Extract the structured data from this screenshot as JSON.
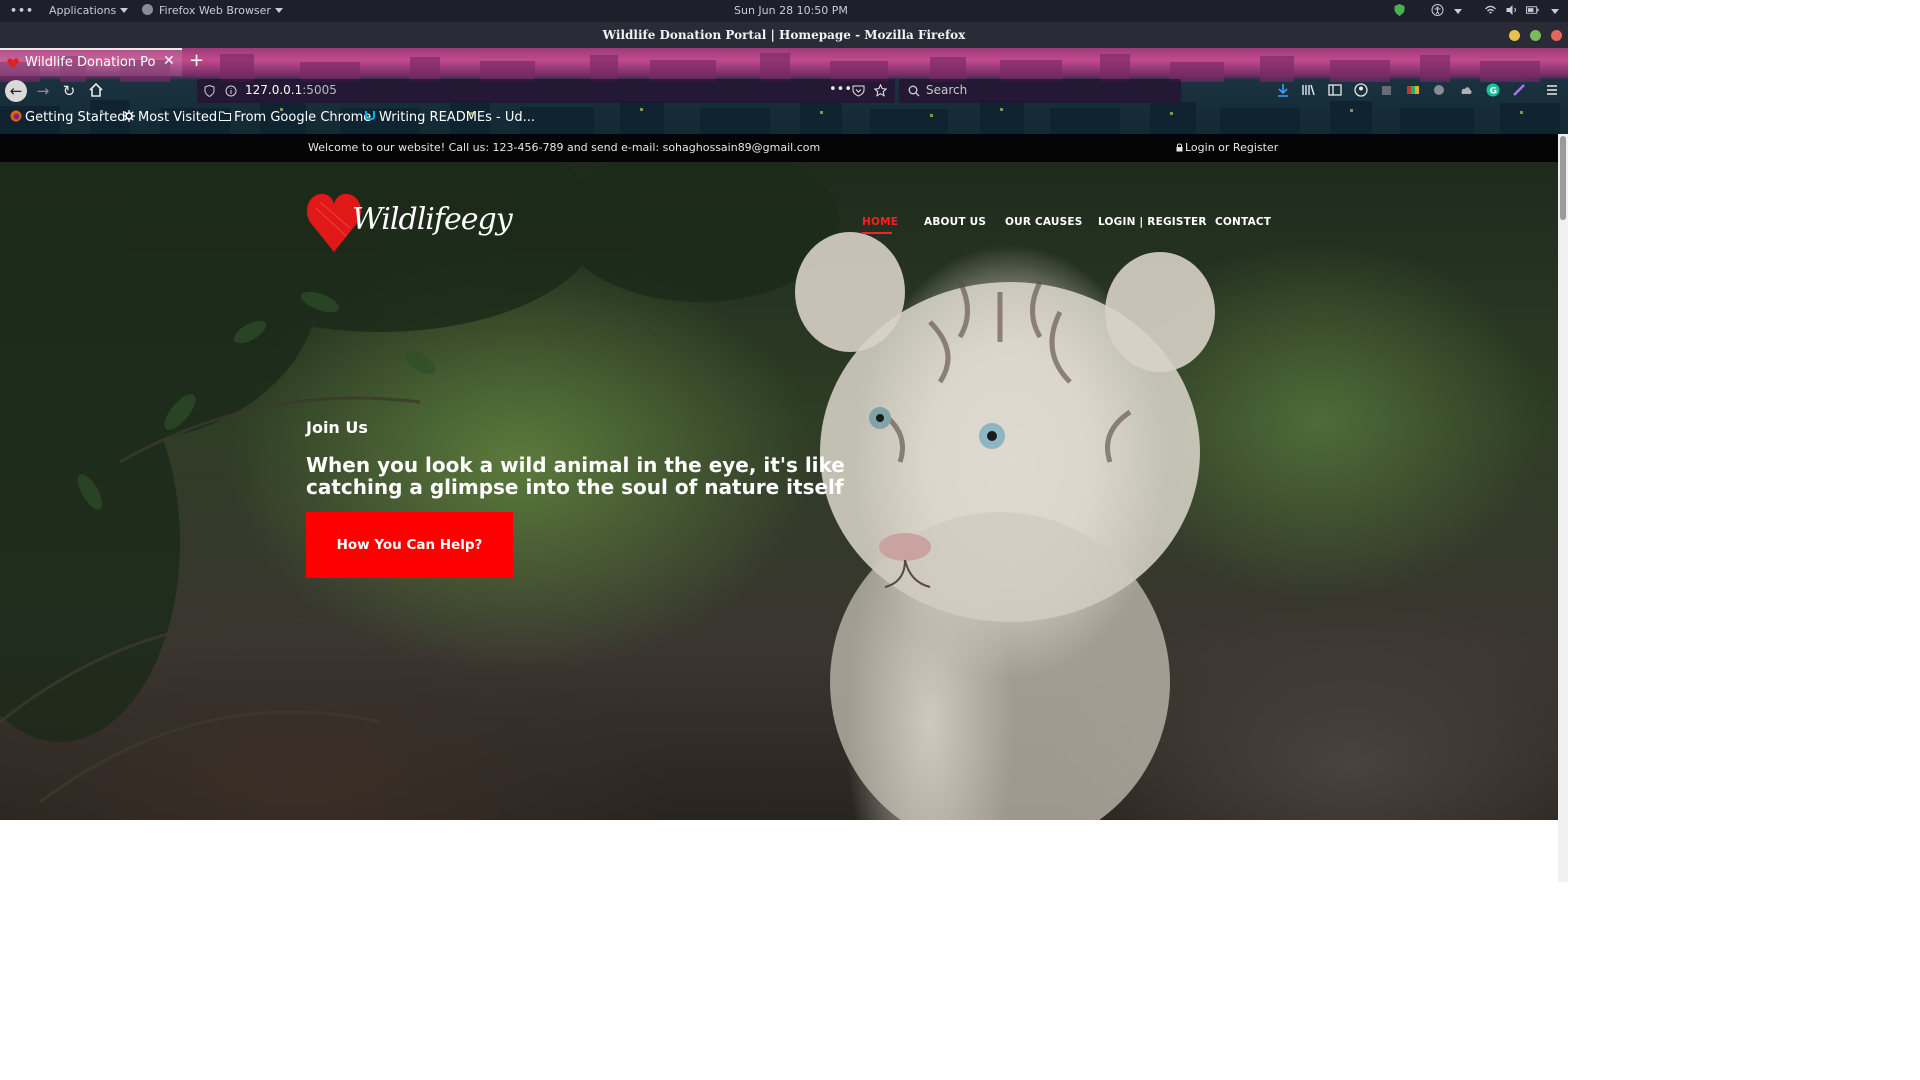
{
  "system_bar": {
    "applications_label": "Applications",
    "browser_label": "Firefox Web Browser",
    "clock": "Sun Jun 28  10:50 PM"
  },
  "window": {
    "title": "Wildlife Donation Portal | Homepage - Mozilla Firefox"
  },
  "browser": {
    "tab_title": "Wildlife Donation Portal | Homepage",
    "url_host": "127.0.0.1",
    "url_port": ":5005",
    "search_placeholder": "Search",
    "bookmarks": [
      {
        "label": "Getting Started",
        "icon": "firefox-icon"
      },
      {
        "label": "Most Visited",
        "icon": "gear-icon"
      },
      {
        "label": "From Google Chrome",
        "icon": "folder-icon"
      },
      {
        "label": "Writing READMEs - Ud...",
        "icon": "udacity-icon"
      }
    ]
  },
  "page": {
    "top_bar": {
      "welcome": "Welcome to our website! Call us: 123-456-789 and send e-mail: sohaghossain89@gmail.com",
      "login": "Login or Register"
    },
    "logo_text": "Wildlifeegy",
    "nav": [
      {
        "label": "HOME",
        "active": true
      },
      {
        "label": "ABOUT US",
        "active": false
      },
      {
        "label": "OUR CAUSES",
        "active": false
      },
      {
        "label": "LOGIN | REGISTER",
        "active": false
      },
      {
        "label": "CONTACT",
        "active": false
      }
    ],
    "hero": {
      "subtitle": "Join Us",
      "title": "When you look a wild animal in the eye, it's like catching a glimpse into the soul of nature itself",
      "button": "How You Can Help?"
    }
  },
  "colors": {
    "accent": "#ff0000",
    "nav_active": "#ff1f1f",
    "top_info_bg": "#050505"
  }
}
